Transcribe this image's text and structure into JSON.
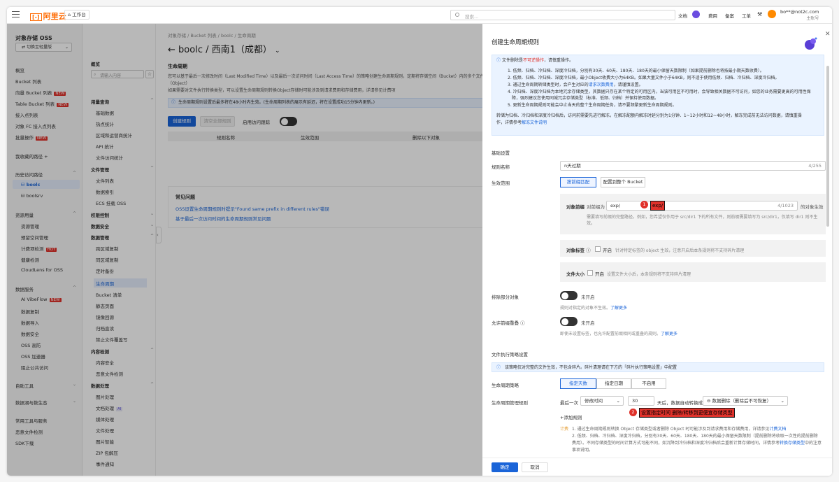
{
  "topbar": {
    "logo": "阿里云",
    "workspace": "工作台",
    "search_placeholder": "搜索...",
    "links": [
      "文档",
      "费用",
      "备案",
      "工单"
    ],
    "user_name": "bo**@not2c.com",
    "user_role": "主账号"
  },
  "sidebar": {
    "title": "对象存储 OSS",
    "switch_label": "切换至轻量版",
    "items": [
      {
        "label": "概览"
      },
      {
        "label": "Bucket 列表"
      },
      {
        "label": "向量 Bucket 列表",
        "badge": "NEW"
      },
      {
        "label": "Table Bucket 列表",
        "badge": "NEW"
      },
      {
        "label": "接入点列表"
      },
      {
        "label": "对象 FC 接入点列表"
      },
      {
        "label": "批量操作",
        "badge": "NEW"
      }
    ],
    "favorites": "我收藏的路径",
    "history": {
      "title": "历史访问路径",
      "items": [
        "boolc",
        "boolsrv"
      ]
    },
    "resource": {
      "title": "资源用量",
      "items": [
        {
          "label": "资源管理"
        },
        {
          "label": "预留空间管理"
        },
        {
          "label": "计费项检测",
          "badge": "HOT"
        },
        {
          "label": "健康检测"
        },
        {
          "label": "CloudLens for OSS"
        }
      ]
    },
    "data_service": {
      "title": "数据服务",
      "items": [
        {
          "label": "AI VibeFlow",
          "badge": "NEW"
        },
        {
          "label": "数据复制"
        },
        {
          "label": "数据导入"
        },
        {
          "label": "数据安全"
        },
        {
          "label": "OSS 高防"
        },
        {
          "label": "OSS 加速器"
        },
        {
          "label": "阻止公共访问"
        }
      ]
    },
    "bottom": [
      "自助工具",
      "数据湖与数生态",
      "常用工具与服务",
      "恶意文件检测",
      "SDK下载"
    ]
  },
  "subnav": {
    "overview": "概览",
    "search_placeholder": "请输入内容",
    "groups": [
      {
        "title": "用量查询",
        "items": [
          "基础数据",
          "热点统计",
          "区域和运营商统计",
          "API 统计",
          "文件访问统计"
        ]
      },
      {
        "title": "文件管理",
        "items": [
          "文件列表",
          "数据索引",
          "ECS 挂载 OSS"
        ]
      },
      {
        "title": "权限控制",
        "items": []
      },
      {
        "title": "数据安全",
        "items": []
      },
      {
        "title": "数据管理",
        "items": [
          "跨区域复制",
          "同区域复制",
          "定时备份",
          "生命周期",
          "Bucket 清单",
          "静态页面",
          "镜像回源",
          "归档直读",
          "禁止文件覆盖写"
        ]
      },
      {
        "title": "内容检测",
        "items": [
          "内容安全",
          "恶意文件检测"
        ]
      },
      {
        "title": "数据处理",
        "items": [
          "图片处理",
          "文档处理",
          "媒体处理",
          "文件处理",
          "图片智能",
          "ZIP 包解压",
          "事件通知"
        ]
      }
    ],
    "doc_ai_badge": "AI"
  },
  "main": {
    "breadcrumb": "对象存储 / Bucket 列表 / boolc / 生命周期",
    "title": "boolc / 西南1（成都）",
    "section": "生命周期",
    "desc1": "您可以基于最后一次修改时间（Last Modified Time）以及最后一次访问时间（Last Access Time）的策略创建生命周期规则，定期将存储空间（Bucket）内的多个文件（Object）",
    "desc2": "如果需要对文件执行转换类型，可以设置生命周期规则转换Object存储时可能涉及到请求费用和存储费用，详请参见计费项",
    "info": "生命周期规则设置后最多将在48小时内生效。(生命周期列表的展示有延迟，将在设置成功15分钟内更新。)",
    "create_btn": "创建规则",
    "batch_btn": "清空全部规则",
    "access_label": "启用访问跟踪",
    "columns": [
      "规则名称",
      "生效范围",
      "删除以下对象"
    ],
    "faq_title": "常见问题",
    "faq_links": [
      "OSS设置生命周期规则时提示\"Found same prefix in different rules\"错误",
      "基于最后一次访问时间的生命周期规则常见问题"
    ]
  },
  "panel": {
    "title": "创建生命周期规则",
    "notice": {
      "head": "文件删除是",
      "head_red": "不可逆操作",
      "head_tail": "，请慎重操作。",
      "lines": [
        "1. 低频、归档、冷归档、深度冷归档，分别有30天、60天、180天、180天的最小保留天数限制（如果提前删除也将按最小期天数收费）。",
        "2. 低频、归档、冷归档、深度冷归档，最小Object收费大小为64KB。如果大量文件小于64KB，则不适于使用低频、归档、冷归档、深度冷归档。",
        "3. 通过生命周期转储类型时，会产生对应的",
        "4. 冷归档、深度冷归档为本地冗余存储类型，其数据只存在某个特定的可用区内，当该可用区不可用时，会导致相关数据不可访问，如您的业务需要更高的可用性保",
        "障，强烈建议您使用同城冗余存储类型（标准、低频、归档）并保持使用数据。",
        "5. 更新生命周期规则可能会中止当天的整个生命周期任务，请不要频繁更新生命周期规则。",
        "转储为归档、冷归档和深度冷归档后，访问前需要先进行解冻，在解冻配额内解冻时延分别为1分钟、1~12小时和12~48小时，解冻完成前无法访问数据，请慎重操",
        "作，详情参考"
      ],
      "req_link": "请求次数费用",
      "req_tail": "，请谨慎设置。",
      "doc_link": "解冻文件说明"
    },
    "basic_title": "基础设置",
    "rule_name_label": "规则名称",
    "rule_name_value": "n天过期",
    "rule_name_count": "4/255",
    "scope_label": "生效范围",
    "scope_opts": [
      "按前缀匹配",
      "配置到整个 Bucket"
    ],
    "prefix_label": "对象前缀",
    "prefix_hint": "对前缀为",
    "prefix_value": "exp/",
    "prefix_count": "4/1023",
    "prefix_tail": "的对象生效",
    "prefix_help": "需要填写前缀的完整路径。例如，您希望仅作用于 src/dir1 下的所有文件，则前缀需要填写为 src/dir1，仅填写 dir1 则不生效。",
    "callout1": "exp/",
    "tag_label": "对象标签",
    "tag_open": "开启",
    "tag_help": "针对特定标签的 object 生效，注意开启后本条规则将不支持碎片清理",
    "size_label": "文件大小",
    "size_open": "开启",
    "size_help": "设置文件大小后，本条规则将不支持碎片清理",
    "exclude_label": "排除部分对象",
    "exclude_off": "未开启",
    "exclude_help": "规则对指定的对象不生效。",
    "more": "了解更多",
    "overlap_label": "允许前缀重叠",
    "overlap_off": "未开启",
    "overlap_help": "即使未设置标签，也允许配置前缀相同或重叠的规则。",
    "exec_title": "文件执行策略设置",
    "exec_info": "该策略仅对完整的文件生效，不包含碎片。碎片清理请在下方的「碎片执行策略设置」中配置",
    "policy_label": "生命周期策略",
    "policy_opts": [
      "指定天数",
      "指定日期",
      "不启用"
    ],
    "rule_label": "生命周期管理规则",
    "rule_prefix": "最后一次",
    "rule_select": "修改时间",
    "rule_days": "30",
    "rule_mid": "天后，数据自动转换成",
    "rule_action": "数据删除（删除后不可恢复）",
    "add_rule": "+添加规则",
    "callout2": "设置指定时间 删除/转移到更便宜存储类型",
    "cost": {
      "label": "计费",
      "l1": "1. 通过生命周期规则转换 Object 存储类型或者删除 Object 时可能涉及到请求费用和存储费用，详请参见",
      "l1_link": "计费文档",
      "l2": "2. 低频、归档、冷归档、深度冷归档，分别有30天、60天、180天、180天的最小保留天数限制（提前删除将收取一次性的提前删除",
      "l3": "费用）。不同存储类型的时间计算方式可能不同，如沉降到冷归档和深度冷归档后会重新计算存储时间，详情参考",
      "l3_link": "转换存储类型",
      "l3_tail": "中的注意",
      "l4": "事项说明。"
    },
    "ok": "确定",
    "cancel": "取消"
  }
}
